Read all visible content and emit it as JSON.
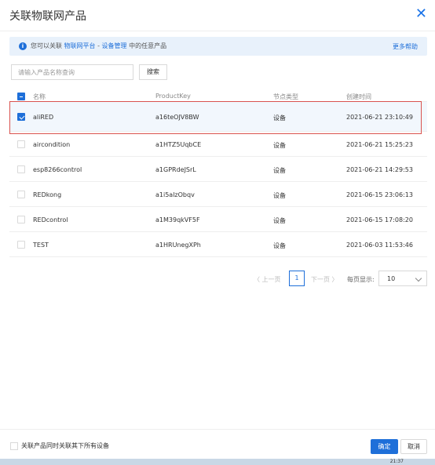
{
  "dialog": {
    "title": "关联物联网产品",
    "close_symbol": "✕"
  },
  "notice": {
    "icon": "info-icon",
    "prefix": "您可以关联",
    "link1": "物联网平台",
    "separator": " - ",
    "link2": "设备管理",
    "suffix": "中的任意产品",
    "more_help": "更多帮助"
  },
  "search": {
    "placeholder": "请输入产品名称查询",
    "button_label": "搜索"
  },
  "table": {
    "columns": [
      "名称",
      "ProductKey",
      "节点类型",
      "创建时间"
    ],
    "rows": [
      {
        "name": "aliRED",
        "key": "a16teOJV8BW",
        "type": "设备",
        "time": "2021-06-21 23:10:49",
        "checked": true
      },
      {
        "name": "aircondition",
        "key": "a1HTZ5UqbCE",
        "type": "设备",
        "time": "2021-06-21 15:25:23",
        "checked": false
      },
      {
        "name": "esp8266control",
        "key": "a1GPRdeJSrL",
        "type": "设备",
        "time": "2021-06-21 14:29:53",
        "checked": false
      },
      {
        "name": "REDkong",
        "key": "a1i5alzObqv",
        "type": "设备",
        "time": "2021-06-15 23:06:13",
        "checked": false
      },
      {
        "name": "REDcontrol",
        "key": "a1M39qkVF5F",
        "type": "设备",
        "time": "2021-06-15 17:08:20",
        "checked": false
      },
      {
        "name": "TEST",
        "key": "a1HRUnegXPh",
        "type": "设备",
        "time": "2021-06-03 11:53:46",
        "checked": false
      }
    ]
  },
  "pagination": {
    "prev": "〈 上一页",
    "current": "1",
    "next": "下一页 〉",
    "page_size_label": "每页显示:",
    "page_size": "10"
  },
  "footer": {
    "checkbox_label": "关联产品同时关联其下所有设备",
    "ok": "确定",
    "cancel": "取消"
  },
  "taskbar": {
    "time": "21:37"
  },
  "colors": {
    "accent": "#1e6fd9",
    "highlight_border": "#d9534f"
  }
}
